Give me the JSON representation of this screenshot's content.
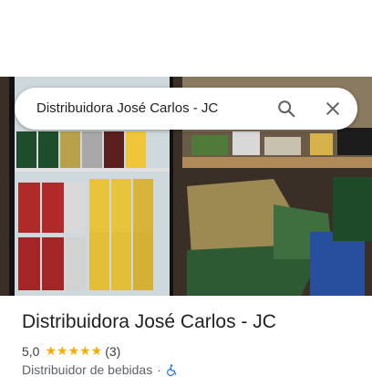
{
  "search": {
    "query": "Distribuidora José Carlos - JC"
  },
  "place": {
    "name": "Distribuidora José Carlos - JC",
    "rating": "5,0",
    "stars": "★★★★★",
    "review_count": "(3)",
    "category": "Distribuidor de bebidas",
    "separator": "·"
  },
  "icons": {
    "search": "search-icon",
    "close": "close-icon",
    "accessibility": "wheelchair-accessible-icon"
  },
  "colors": {
    "star": "#f9ab00",
    "accessibility": "#1a73e8",
    "text": "#202124"
  }
}
